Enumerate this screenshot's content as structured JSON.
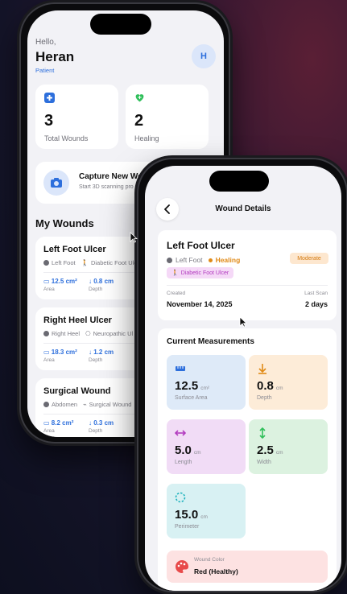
{
  "home": {
    "greeting": "Hello,",
    "name": "Heran",
    "role": "Patient",
    "avatar_initial": "H",
    "stats": [
      {
        "value": "3",
        "label": "Total Wounds",
        "icon": "medkit-icon",
        "color": "#2d6fdc"
      },
      {
        "value": "2",
        "label": "Healing",
        "icon": "heart-plus-icon",
        "color": "#2fbf5a"
      }
    ],
    "capture": {
      "title": "Capture New Wo",
      "subtitle": "Start 3D scanning pro"
    },
    "section_title": "My Wounds",
    "wounds": [
      {
        "name": "Left Foot Ulcer",
        "location": "Left Foot",
        "type": "Diabetic Foot Ulc",
        "area": "12.5 cm²",
        "area_label": "Area",
        "depth": "0.8 cm",
        "depth_label": "Depth"
      },
      {
        "name": "Right Heel Ulcer",
        "location": "Right Heel",
        "type": "Neuropathic Ul",
        "area": "18.3 cm²",
        "area_label": "Area",
        "depth": "1.2 cm",
        "depth_label": "Depth"
      },
      {
        "name": "Surgical Wound",
        "location": "Abdomen",
        "type": "Surgical Wound",
        "area": "8.2 cm²",
        "area_label": "Area",
        "depth": "0.3 cm",
        "depth_label": "Depth"
      }
    ]
  },
  "details": {
    "title": "Wound Details",
    "wound_name": "Left Foot Ulcer",
    "location": "Left Foot",
    "status": "Healing",
    "severity": "Moderate",
    "type": "Diabetic Foot Ulcer",
    "created_label": "Created",
    "created_value": "November 14, 2025",
    "last_scan_label": "Last Scan",
    "last_scan_value": "2 days",
    "measurements_title": "Current Measurements",
    "measurements": [
      {
        "value": "12.5",
        "unit": "cm²",
        "label": "Surface Area",
        "icon": "ruler-icon",
        "bg": "#deeaf8",
        "color": "#2d6fdc"
      },
      {
        "value": "0.8",
        "unit": "cm",
        "label": "Depth",
        "icon": "arrow-down-icon",
        "bg": "#fdecd8",
        "color": "#e08a17"
      },
      {
        "value": "5.0",
        "unit": "cm",
        "label": "Length",
        "icon": "arrows-horizontal-icon",
        "bg": "#f1dcf6",
        "color": "#b23bbf"
      },
      {
        "value": "2.5",
        "unit": "cm",
        "label": "Width",
        "icon": "arrows-vertical-icon",
        "bg": "#dcf2e0",
        "color": "#2fbf5a"
      },
      {
        "value": "15.0",
        "unit": "cm",
        "label": "Perimeter",
        "icon": "circle-dashed-icon",
        "bg": "#d8f1f3",
        "color": "#1fb3bd"
      }
    ],
    "wound_color_label": "Wound Color",
    "wound_color_value": "Red (Healthy)"
  }
}
